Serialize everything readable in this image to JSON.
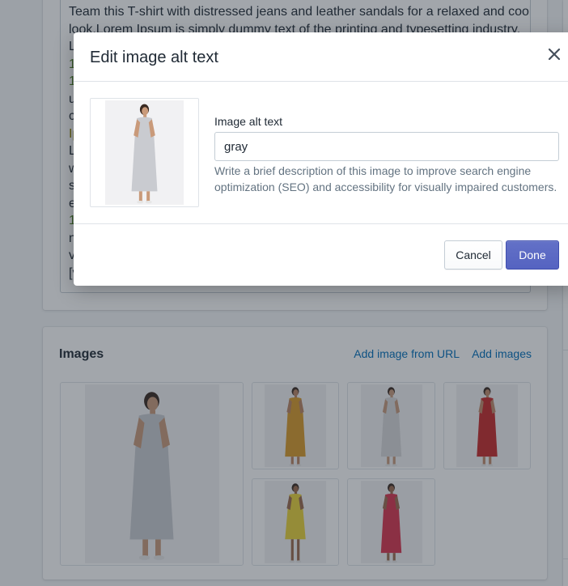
{
  "description_editor": {
    "lines": [
      {
        "text": "Team this T-shirt with distressed jeans and leather sandals for a relaxed and cool",
        "style": "normal"
      },
      {
        "text": "look.Lorem Ipsum is simply dummy text of the printing and typesetting industry.",
        "style": "normal"
      },
      {
        "text": "L",
        "style": "normal"
      },
      {
        "text": "1",
        "style": "green"
      },
      {
        "text": "1",
        "style": "green"
      },
      {
        "text": "u",
        "style": "normal"
      },
      {
        "text": "c",
        "style": "normal"
      },
      {
        "text": "Ip",
        "style": "olive"
      },
      {
        "text": "L",
        "style": "normal"
      },
      {
        "text": "w",
        "style": "normal"
      },
      {
        "text": "s",
        "style": "normal"
      },
      {
        "text": "e",
        "style": "normal"
      },
      {
        "text": "1",
        "style": "green"
      },
      {
        "text": "n",
        "style": "normal"
      },
      {
        "text": "v",
        "style": "normal"
      },
      {
        "text": "[v",
        "style": "normal"
      }
    ]
  },
  "images_section": {
    "title": "Images",
    "add_from_url_label": "Add image from URL",
    "add_images_label": "Add images",
    "thumbnails": [
      {
        "name": "gray-dress",
        "dress_color": "#c9cbd0",
        "skin": "#c99a7a"
      },
      {
        "name": "yellow-floral-dress",
        "dress_color": "#d79a2a",
        "skin": "#b98463"
      },
      {
        "name": "white-dress",
        "dress_color": "#d8d8da",
        "skin": "#c79a7c"
      },
      {
        "name": "red-dress",
        "dress_color": "#c42a2a",
        "skin": "#c08a6c"
      },
      {
        "name": "yellow-short-dress",
        "dress_color": "#e8d23a",
        "skin": "#9a6a4c"
      },
      {
        "name": "pink-red-dress",
        "dress_color": "#d8354f",
        "skin": "#9c6c50"
      }
    ]
  },
  "modal": {
    "title": "Edit image alt text",
    "field_label": "Image alt text",
    "alt_value": "gray",
    "help_text": "Write a brief description of this image to improve search engine optimization (SEO) and accessibility for visually impaired customers.",
    "cancel_label": "Cancel",
    "done_label": "Done",
    "close_icon": "close-icon"
  },
  "colors": {
    "primary": "#5c6ac4",
    "link": "#006fbb",
    "border": "#dfe3e8"
  }
}
